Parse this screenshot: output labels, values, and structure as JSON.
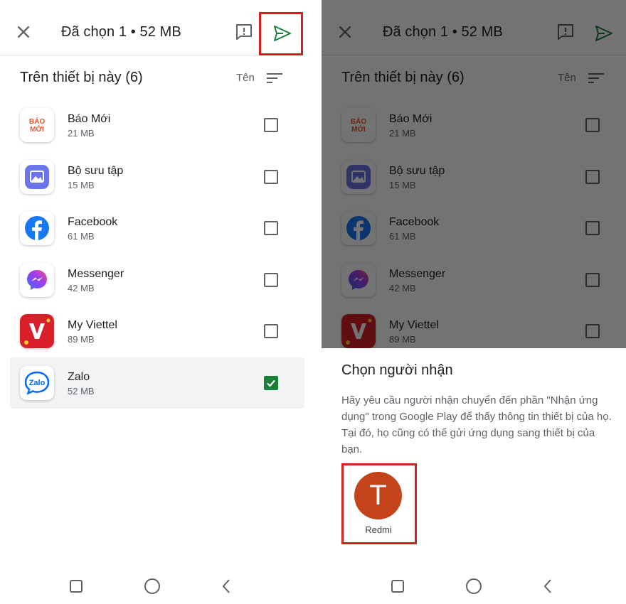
{
  "topbar": {
    "title": "Đã chọn 1 • 52 MB"
  },
  "list": {
    "section_title": "Trên thiết bị này (6)",
    "sort_label": "Tên",
    "apps": [
      {
        "name": "Báo Mới",
        "size": "21 MB",
        "icon": "baomoi-icon",
        "checked": false
      },
      {
        "name": "Bộ sưu tập",
        "size": "15 MB",
        "icon": "gallery-icon",
        "checked": false
      },
      {
        "name": "Facebook",
        "size": "61 MB",
        "icon": "facebook-icon",
        "checked": false
      },
      {
        "name": "Messenger",
        "size": "42 MB",
        "icon": "messenger-icon",
        "checked": false
      },
      {
        "name": "My Viettel",
        "size": "89 MB",
        "icon": "viettel-icon",
        "checked": false
      },
      {
        "name": "Zalo",
        "size": "52 MB",
        "icon": "zalo-icon",
        "checked": true
      }
    ]
  },
  "icons": {
    "baomoi_text": "BÁO MỚI",
    "zalo_text": "Zalo"
  },
  "sheet": {
    "title": "Chọn người nhận",
    "description": "Hãy yêu cầu người nhận chuyển đến phần \"Nhận ứng dụng\" trong Google Play để thấy thông tin thiết bị của họ. Tại đó, họ cũng có thể gửi ứng dụng sang thiết bị của bạn.",
    "recipient": {
      "initial": "T",
      "name": "Redmi",
      "avatar_color": "#c5431b"
    }
  },
  "colors": {
    "accent_green": "#188038",
    "highlight_red": "#d51e1e"
  }
}
